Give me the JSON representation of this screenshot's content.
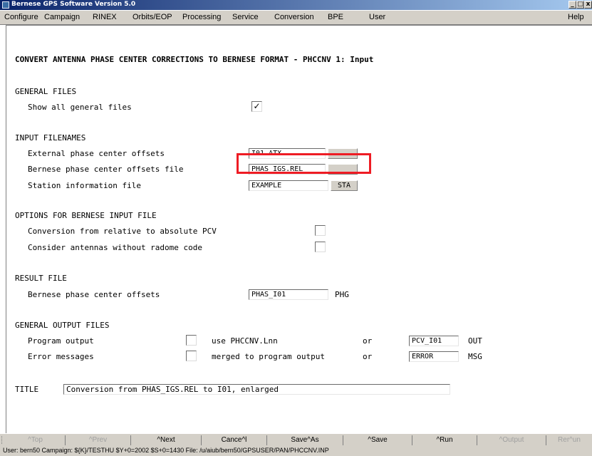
{
  "window": {
    "title": "Bernese GPS Software Version 5.0",
    "min_label": "_",
    "max_label": "□",
    "close_label": "x"
  },
  "menu": {
    "items": [
      {
        "label": "Configure"
      },
      {
        "label": "Campaign"
      },
      {
        "label": "RINEX"
      },
      {
        "label": "Orbits/EOP"
      },
      {
        "label": "Processing"
      },
      {
        "label": "Service"
      },
      {
        "label": "Conversion"
      },
      {
        "label": "BPE"
      },
      {
        "label": "User"
      }
    ],
    "help": "Help"
  },
  "form": {
    "heading": "CONVERT ANTENNA PHASE CENTER CORRECTIONS TO BERNESE FORMAT - PHCCNV 1: Input",
    "general_files": {
      "section": "GENERAL FILES",
      "show_all_label": "Show all general files",
      "show_all_checked": true,
      "check_glyph": "✓"
    },
    "input_filenames": {
      "section": "INPUT FILENAMES",
      "rows": [
        {
          "label": "External phase center offsets",
          "value": "I01.ATX",
          "ext": ""
        },
        {
          "label": "Bernese phase center offsets file",
          "value": "PHAS_IGS.REL",
          "ext": ""
        },
        {
          "label": "Station information file",
          "value": "EXAMPLE",
          "ext": "STA"
        }
      ]
    },
    "options": {
      "section": "OPTIONS FOR BERNESE INPUT FILE",
      "rows": [
        {
          "label": "Conversion from relative to absolute PCV",
          "checked": false
        },
        {
          "label": "Consider antennas without radome code",
          "checked": false
        }
      ]
    },
    "result_file": {
      "section": "RESULT FILE",
      "label": "Bernese phase center offsets",
      "value": "PHAS_I01",
      "ext": "PHG"
    },
    "output_files": {
      "section": "GENERAL OUTPUT FILES",
      "rows": [
        {
          "label": "Program output",
          "checked": false,
          "desc": "use PHCCNV.Lnn",
          "or": "or",
          "value": "PCV_I01",
          "ext": "OUT"
        },
        {
          "label": "Error messages",
          "checked": false,
          "desc": "merged to program output",
          "or": "or",
          "value": "ERROR",
          "ext": "MSG"
        }
      ]
    },
    "title": {
      "label": "TITLE",
      "value": "Conversion from PHAS_IGS.REL to I01, enlarged"
    }
  },
  "buttons": {
    "top": "^Top",
    "prev": "^Prev",
    "next": "^Next",
    "cancel": "Cance^l",
    "saveas": "Save^As",
    "save": "^Save",
    "run": "^Run",
    "output": "^Output",
    "rerun": "Rer^un"
  },
  "status": "User: bern50   Campaign: ${K}/TESTHU   $Y+0=2002   $S+0=1430   File: /u/aiub/bern50/GPSUSER/PAN/PHCCNV.INP"
}
